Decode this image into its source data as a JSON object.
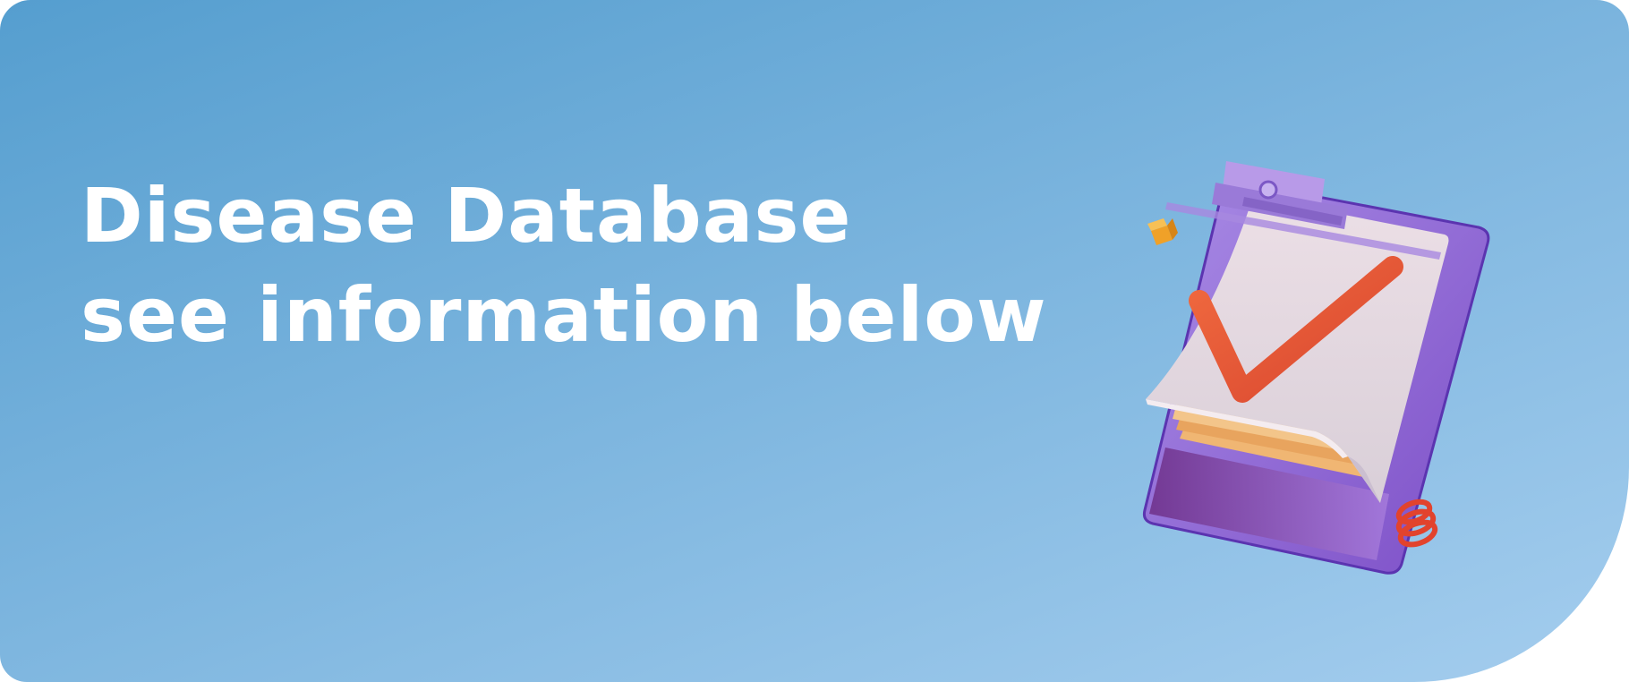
{
  "banner": {
    "title_line_1": "Disease Database",
    "title_line_2": "see information below",
    "illustration": "clipboard-checkmark-icon"
  },
  "colors": {
    "gradient_start": "#559ecf",
    "gradient_end": "#a4cdee",
    "text": "#ffffff",
    "clipboard": "#9b7fd9",
    "checkmark": "#e8573a",
    "cube": "#f0a128"
  }
}
